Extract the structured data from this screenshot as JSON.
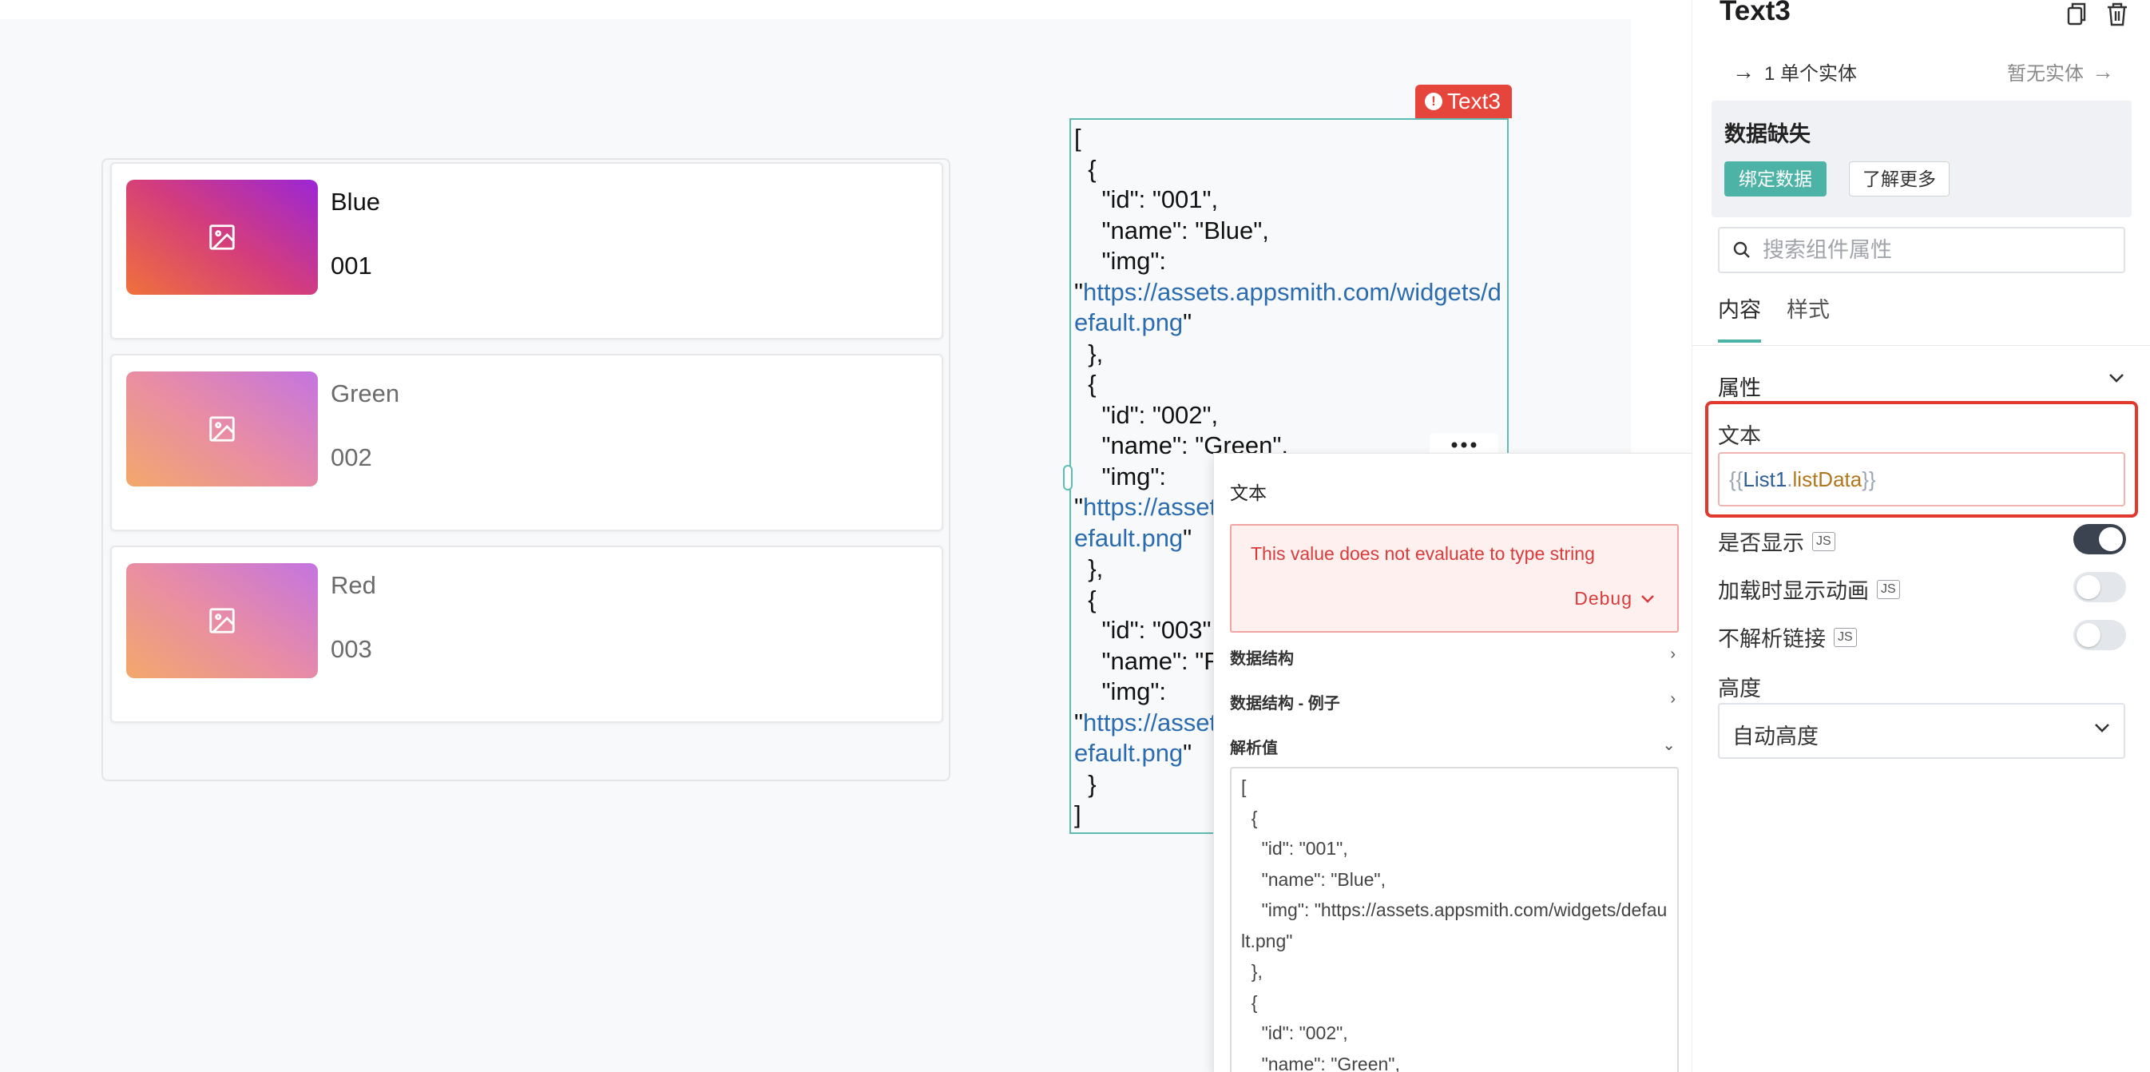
{
  "list": {
    "items": [
      {
        "name": "Blue",
        "id": "001"
      },
      {
        "name": "Green",
        "id": "002"
      },
      {
        "name": "Red",
        "id": "003"
      }
    ]
  },
  "text_widget": {
    "tag": "Text3",
    "json_lines": [
      "[",
      "  {",
      "    \"id\": \"001\",",
      "    \"name\": \"Blue\",",
      "    \"img\":",
      "\"https://assets.appsmith.com/widgets/default.png\"",
      "  },",
      "  {",
      "    \"id\": \"002\",",
      "    \"name\": \"Green\",",
      "    \"img\":",
      "\"https://assets.appsmith.com/widgets/default.png\"",
      "  },",
      "  {",
      "    \"id\": \"003\",",
      "    \"name\": \"Red\",",
      "    \"img\":",
      "\"https://assets.appsmith.com/widgets/default.png\"",
      "  }",
      "]"
    ]
  },
  "popup": {
    "title": "文本",
    "error_message": "This value does not evaluate to type string",
    "debug_label": "Debug",
    "sections": [
      {
        "label": "数据结构",
        "chevron": "›"
      },
      {
        "label": "数据结构 - 例子",
        "chevron": "›"
      },
      {
        "label": "解析值",
        "chevron": "⌄"
      }
    ],
    "evaluated_value": "[\n  {\n    \"id\": \"001\",\n    \"name\": \"Blue\",\n    \"img\": \"https://assets.appsmith.com/widgets/default.png\"\n  },\n  {\n    \"id\": \"002\",\n    \"name\": \"Green\","
  },
  "panel": {
    "title": "Text3",
    "entity_label": "1 单个实体",
    "no_entity_label": "暂无实体",
    "missing": {
      "title": "数据缺失",
      "bind_button": "绑定数据",
      "learn_button": "了解更多"
    },
    "search_placeholder": "搜索组件属性",
    "tabs": [
      "内容",
      "样式"
    ],
    "section_title": "属性",
    "text_label": "文本",
    "text_value": {
      "open": "{{",
      "object": "List1",
      "dot": ".",
      "property": "listData",
      "close": "}}"
    },
    "visible_label": "是否显示",
    "animate_label": "加载时显示动画",
    "links_label": "不解析链接",
    "js_badge": "JS",
    "height_label": "高度",
    "height_value": "自动高度",
    "toggles": {
      "visible": true,
      "animate": false,
      "links": false
    }
  },
  "colors": {
    "accent": "#4cb3a6",
    "error": "#e5453b",
    "widget_border": "#5fbcb4",
    "link": "#2b6cb0"
  }
}
